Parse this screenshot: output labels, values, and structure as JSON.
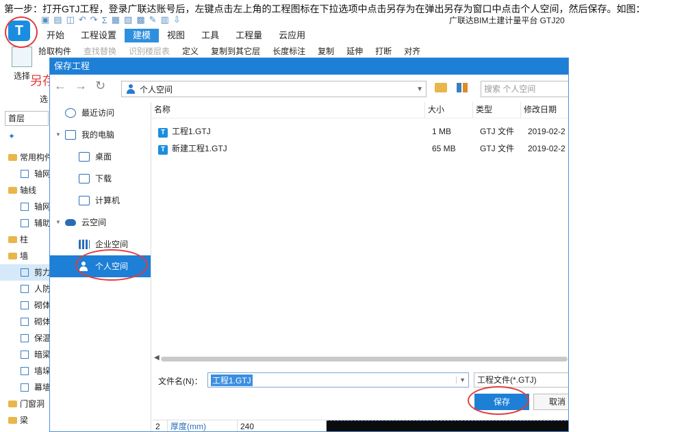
{
  "instruction": "第一步：打开GTJ工程，登录广联达账号后，左键点击左上角的工程图标在下拉选项中点击另存为在弹出另存为窗口中点击个人空间，然后保存。如图：",
  "app": {
    "logo_letter": "T",
    "platform_title": "广联达BIM土建计量平台 GTJ20",
    "menu": [
      "开始",
      "工程设置",
      "建模",
      "视图",
      "工具",
      "工程量",
      "云应用"
    ],
    "active_menu": "建模",
    "ribbon": [
      "拾取构件",
      "查找替换",
      "识别楼层表",
      "定义",
      "复制到其它层",
      "长度标注",
      "复制",
      "延伸",
      "打断",
      "对齐"
    ],
    "select_tool": "选择",
    "select_tool_sub": "选",
    "save_as_annotation": "另存为",
    "floor": "首层",
    "tree": [
      {
        "label": "常用构件",
        "type": "cat"
      },
      {
        "label": "轴网",
        "type": "sub"
      },
      {
        "label": "轴线",
        "type": "cat"
      },
      {
        "label": "轴网",
        "type": "sub"
      },
      {
        "label": "辅助",
        "type": "sub"
      },
      {
        "label": "柱",
        "type": "cat"
      },
      {
        "label": "墙",
        "type": "cat"
      },
      {
        "label": "剪力",
        "type": "sub",
        "selected": true
      },
      {
        "label": "人防",
        "type": "sub"
      },
      {
        "label": "砌体",
        "type": "sub"
      },
      {
        "label": "砌体",
        "type": "sub"
      },
      {
        "label": "保温",
        "type": "sub"
      },
      {
        "label": "暗梁",
        "type": "sub"
      },
      {
        "label": "墙垛",
        "type": "sub"
      },
      {
        "label": "幕墙",
        "type": "sub"
      },
      {
        "label": "门窗洞",
        "type": "cat"
      },
      {
        "label": "梁",
        "type": "cat"
      }
    ]
  },
  "dialog": {
    "title": "保存工程",
    "address": "个人空间",
    "search_placeholder": "搜索 个人空间",
    "nav": {
      "recent": "最近访问",
      "my_computer": "我的电脑",
      "desktop": "桌面",
      "downloads": "下载",
      "computer": "计算机",
      "cloud": "云空间",
      "enterprise": "企业空间",
      "personal": "个人空间"
    },
    "columns": {
      "name": "名称",
      "size": "大小",
      "type": "类型",
      "modified": "修改日期"
    },
    "files": [
      {
        "name": "工程1.GTJ",
        "size": "1 MB",
        "type": "GTJ 文件",
        "modified": "2019-02-2"
      },
      {
        "name": "新建工程1.GTJ",
        "size": "65 MB",
        "type": "GTJ 文件",
        "modified": "2019-02-2"
      }
    ],
    "filename_label": "文件名(N)：",
    "filename_value": "工程1.GTJ",
    "filetype": "工程文件(*.GTJ)",
    "save": "保存",
    "cancel": "取消"
  },
  "property_row": {
    "index": "2",
    "name": "厚度(mm)",
    "value": "240"
  }
}
